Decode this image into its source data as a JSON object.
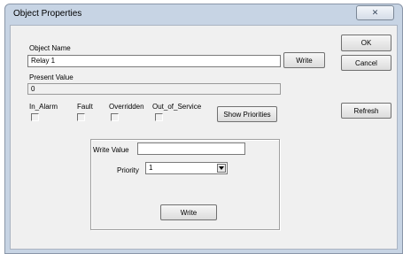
{
  "window": {
    "title": "Object Properties",
    "close_glyph": "✕"
  },
  "object_name": {
    "label": "Object Name",
    "value": "Relay 1",
    "write_button": "Write"
  },
  "present_value": {
    "label": "Present Value",
    "value": "0"
  },
  "status_flags": [
    {
      "label": "In_Alarm",
      "checked": false
    },
    {
      "label": "Fault",
      "checked": false
    },
    {
      "label": "Overridden",
      "checked": false
    },
    {
      "label": "Out_of_Service",
      "checked": false
    }
  ],
  "buttons": {
    "ok": "OK",
    "cancel": "Cancel",
    "refresh": "Refresh",
    "show_priorities": "Show Priorities"
  },
  "write_group": {
    "write_value_label": "Write Value",
    "write_value": "",
    "priority_label": "Priority",
    "priority_selected": "1",
    "write_button": "Write"
  }
}
